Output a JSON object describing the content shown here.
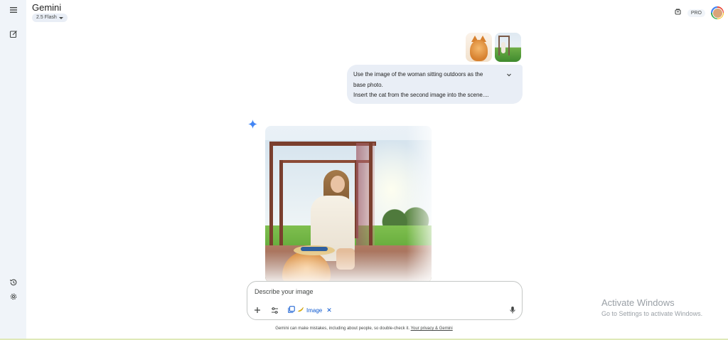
{
  "app": {
    "title": "Gemini",
    "model_label": "2.5 Flash"
  },
  "header": {
    "pro_badge": "PRO"
  },
  "rail": {
    "icons": [
      "menu-icon",
      "new-chat-icon",
      "activity-icon",
      "settings-icon"
    ]
  },
  "user_message": {
    "attachments": [
      "cat-image",
      "woman-outdoors-image"
    ],
    "lines": [
      "Use the image of the woman sitting outdoors as the",
      "base photo.",
      "Insert the cat from the second image into the scene...."
    ]
  },
  "composer": {
    "placeholder": "Describe your image",
    "tool_chip_label": "Image"
  },
  "disclaimer": {
    "text": "Gemini can make mistakes, including about people, so double-check it.",
    "link": "Your privacy & Gemini"
  },
  "watermark": {
    "title": "Activate Windows",
    "subtitle": "Go to Settings to activate Windows."
  },
  "colors": {
    "rail_bg": "#f0f4f9",
    "bubble_bg": "#e9eef6",
    "accent": "#0b57d0",
    "spark": "#4285f4"
  }
}
